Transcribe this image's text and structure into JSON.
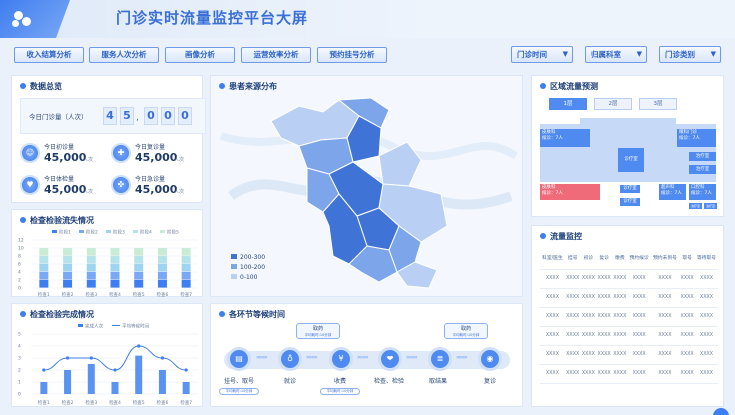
{
  "header": {
    "title": "门诊实时流量监控平台大屏"
  },
  "toolbar": {
    "buttons": [
      "收入结算分析",
      "服务人次分析",
      "画像分析",
      "运营效率分析",
      "预约挂号分析"
    ],
    "selects": [
      "门诊时间",
      "归属科室",
      "门诊类别"
    ]
  },
  "overview": {
    "title": "数据总览",
    "today_label": "今日门诊量（人次）",
    "digits": [
      "4",
      "5",
      "0",
      "0",
      "0"
    ],
    "stats": [
      {
        "label": "今日初诊量",
        "value": "45,000",
        "unit": "人次",
        "icon": "user-icon"
      },
      {
        "label": "今日复诊量",
        "value": "45,000",
        "unit": "人次",
        "icon": "medkit-icon"
      },
      {
        "label": "今日体检量",
        "value": "45,000",
        "unit": "人次",
        "icon": "heart-icon"
      },
      {
        "label": "今日急诊量",
        "value": "45,000",
        "unit": "人次",
        "icon": "emergency-icon"
      }
    ]
  },
  "loss": {
    "title": "检查检验流失情况",
    "legend": [
      "阶段1",
      "阶段2",
      "阶段3",
      "阶段4",
      "阶段5"
    ],
    "yticks": [
      "12",
      "10",
      "8",
      "6",
      "4",
      "2",
      "0"
    ],
    "categories": [
      "检查1",
      "检查2",
      "检查3",
      "检查4",
      "检查5",
      "检查6",
      "检查7"
    ]
  },
  "completion": {
    "title": "检查检验完成情况",
    "legend": [
      "完成人次",
      "平均等候时间"
    ],
    "yticks": [
      "5",
      "4",
      "3",
      "2",
      "1",
      "0"
    ],
    "categories": [
      "检查1",
      "检查2",
      "检查3",
      "检查4",
      "检查5",
      "检查6",
      "检查7"
    ]
  },
  "chart_data": [
    {
      "type": "bar",
      "title": "检查检验流失情况",
      "categories": [
        "检查1",
        "检查2",
        "检查3",
        "检查4",
        "检查5",
        "检查6",
        "检查7"
      ],
      "ylim": [
        0,
        12
      ],
      "series": [
        {
          "name": "阶段1",
          "values": [
            2,
            2,
            2,
            2,
            2,
            2,
            2
          ]
        },
        {
          "name": "阶段2",
          "values": [
            2,
            2,
            2,
            2,
            2,
            2,
            2
          ]
        },
        {
          "name": "阶段3",
          "values": [
            2,
            2,
            2,
            2,
            2,
            2,
            2
          ]
        },
        {
          "name": "阶段4",
          "values": [
            2,
            2,
            2,
            2,
            2,
            2,
            2
          ]
        },
        {
          "name": "阶段5",
          "values": [
            2,
            2,
            2,
            2,
            2,
            2,
            2
          ]
        }
      ],
      "grid": true,
      "legend_position": "top"
    },
    {
      "type": "bar",
      "title": "检查检验完成情况",
      "categories": [
        "检查1",
        "检查2",
        "检查3",
        "检查4",
        "检查5",
        "检查6",
        "检查7"
      ],
      "ylim": [
        0,
        5
      ],
      "series": [
        {
          "name": "完成人次",
          "values": [
            1,
            2,
            2.5,
            1,
            3.2,
            2,
            1
          ]
        },
        {
          "name": "平均等候时间",
          "type": "line",
          "values": [
            2,
            3,
            3,
            2,
            4,
            3,
            2
          ]
        }
      ],
      "grid": true,
      "legend_position": "top"
    }
  ],
  "map": {
    "title": "患者来源分布",
    "legend": [
      {
        "label": "200-300",
        "color": "#3f74d6"
      },
      {
        "label": "100-200",
        "color": "#7da5ea"
      },
      {
        "label": "0-100",
        "color": "#b9d0f4"
      }
    ]
  },
  "forecast": {
    "title": "区域流量预测",
    "tabs": [
      "1层",
      "2层",
      "3层"
    ],
    "rooms": [
      {
        "name": "皮肤科",
        "wait": "候诊：7人",
        "color": "#4f8af0"
      },
      {
        "name": "眼科门诊",
        "wait": "候诊：7人",
        "color": "#4f8af0"
      },
      {
        "name": "皮肤科",
        "wait": "候诊：7人",
        "color": "#f06b7a"
      },
      {
        "name": "超声科",
        "wait": "候诊：7人",
        "color": "#4f8af0"
      },
      {
        "name": "口腔科",
        "wait": "候诊：7人",
        "color": "#4f8af0"
      }
    ],
    "small": [
      "诊疗室",
      "诊疗室",
      "治疗室",
      "治疗室",
      "治疗室",
      "治疗室",
      "诊疗室"
    ]
  },
  "flow_monitor": {
    "title": "流量监控",
    "headers": [
      "科室/医生",
      "挂号",
      "初诊",
      "复诊",
      "缴费",
      "预约候诊",
      "预约未到号",
      "取号",
      "等待取号"
    ],
    "cell": "XXXX",
    "rows": 6
  },
  "waiting": {
    "title": "各环节等候时间",
    "steps": [
      "挂号、取号",
      "就诊",
      "收费",
      "检查、检验",
      "取结果",
      "复诊"
    ],
    "bubbles": [
      {
        "label": "取药",
        "sub": "平均耗时:10分钟"
      },
      {
        "label": "取药",
        "sub": "平均耗时:10分钟"
      }
    ],
    "pills": [
      "平均耗时:10分钟",
      "平均耗时:10分钟"
    ]
  }
}
